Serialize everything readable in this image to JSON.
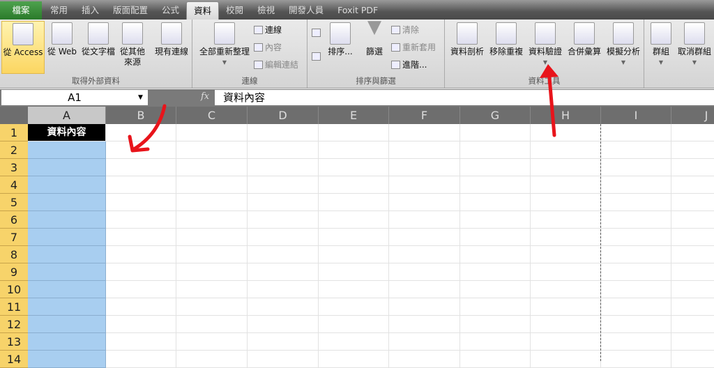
{
  "tabs": [
    "檔案",
    "常用",
    "插入",
    "版面配置",
    "公式",
    "資料",
    "校閱",
    "檢視",
    "開發人員",
    "Foxit PDF"
  ],
  "active_tab": "資料",
  "ribbon": {
    "groups": [
      {
        "label": "取得外部資料",
        "buttons": [
          "從 Access",
          "從 Web",
          "從文字檔",
          "從其他\n來源",
          "現有連線"
        ]
      },
      {
        "label": "連線",
        "buttons": [
          "全部重新整理"
        ],
        "small": [
          "連線",
          "內容",
          "編輯連結"
        ]
      },
      {
        "label": "排序與篩選",
        "buttons": [
          "排序...",
          "篩選"
        ],
        "small": [
          "清除",
          "重新套用",
          "進階..."
        ]
      },
      {
        "label": "資料工具",
        "buttons": [
          "資料剖析",
          "移除重複",
          "資料驗證",
          "合併彙算",
          "模擬分析"
        ]
      },
      {
        "label": "",
        "buttons": [
          "群組",
          "取消群組"
        ]
      }
    ]
  },
  "formula_bar": {
    "name_box": "A1",
    "fx": "fx",
    "value": "資料內容"
  },
  "columns": [
    "A",
    "B",
    "C",
    "D",
    "E",
    "F",
    "G",
    "H",
    "I",
    "J"
  ],
  "rows": [
    "1",
    "2",
    "3",
    "4",
    "5",
    "6",
    "7",
    "8",
    "9",
    "10",
    "11",
    "12",
    "13",
    "14"
  ],
  "cells": {
    "A1": "資料內容"
  },
  "colors": {
    "selection": "#a8cef0",
    "header_cell": "#000000",
    "row_header_selected": "#f7d36a",
    "annotation_arrow": "#e8141b"
  }
}
